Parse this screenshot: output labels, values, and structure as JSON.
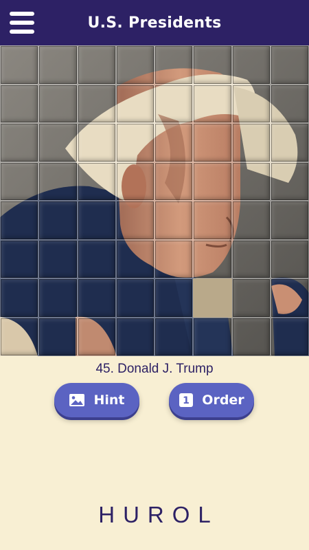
{
  "header": {
    "title": "U.S. Presidents",
    "menu_icon": "hamburger-menu-icon"
  },
  "puzzle": {
    "columns": 8,
    "rows": 8,
    "empty_cell": {
      "row": 6,
      "col": 5
    },
    "palette": {
      "background": "#7a766e",
      "suit": "#1f2d4f",
      "skin": "#c98f73",
      "hair": "#e9dcc2",
      "empty": "#b9a98a"
    }
  },
  "caption": "45. Donald J. Trump",
  "buttons": {
    "hint": {
      "label": "Hint",
      "icon": "image-icon"
    },
    "order": {
      "label": "Order",
      "icon": "number-one-icon",
      "icon_text": "1"
    }
  },
  "footer": {
    "logo": "HUROL"
  }
}
